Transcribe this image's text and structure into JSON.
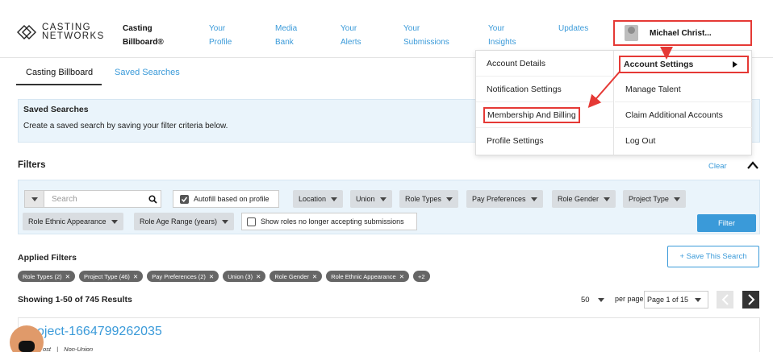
{
  "logo": {
    "line1": "CASTING",
    "line2": "NETWORKS"
  },
  "nav": {
    "items": [
      {
        "line1": "Casting",
        "line2": "Billboard®"
      },
      {
        "line1": "Your",
        "line2": "Profile"
      },
      {
        "line1": "Media",
        "line2": "Bank"
      },
      {
        "line1": "Your",
        "line2": "Alerts"
      },
      {
        "line1": "Your",
        "line2": "Submissions"
      },
      {
        "line1": "Your",
        "line2": "Insights"
      },
      {
        "line1": "",
        "line2": "Updates"
      }
    ],
    "user_name": "Michael Christ..."
  },
  "tabs": [
    {
      "label": "Casting Billboard"
    },
    {
      "label": "Saved Searches"
    }
  ],
  "saved_searches": {
    "title": "Saved Searches",
    "description": "Create a saved search by saving your filter criteria below."
  },
  "filters": {
    "title": "Filters",
    "clear": "Clear",
    "search_placeholder": "Search",
    "autofill_label": "Autofill based on profile",
    "dropdowns_row1": [
      "Location",
      "Union",
      "Role Types",
      "Pay Preferences",
      "Role Gender",
      "Project Type"
    ],
    "dropdowns_row2": [
      "Role Ethnic Appearance",
      "Role Age Range (years)"
    ],
    "show_roles_label": "Show roles no longer accepting submissions",
    "filter_button": "Filter"
  },
  "applied": {
    "title": "Applied Filters",
    "save_button": "+ Save This Search",
    "tags": [
      "Role Types (2)",
      "Project Type (46)",
      "Pay Preferences (2)",
      "Union (3)",
      "Role Gender",
      "Role Ethnic Appearance",
      "+2"
    ]
  },
  "results": {
    "count_text": "Showing 1-50 of 745 Results",
    "per_page_value": "50",
    "per_page_label": "per page",
    "page_value": "Page 1 of 15"
  },
  "project": {
    "title": "oject-1664799262035",
    "meta_left": "ost",
    "meta_right": "Non-Union"
  },
  "dropdown": {
    "left": [
      "Account Details",
      "Notification Settings",
      "Membership And Billing",
      "Profile Settings"
    ],
    "right": [
      "Account Settings",
      "Manage Talent",
      "Claim Additional Accounts",
      "Log Out"
    ]
  },
  "colors": {
    "accent": "#3a9ad9",
    "annotation": "#e53935",
    "panel": "#eaf4fb"
  }
}
